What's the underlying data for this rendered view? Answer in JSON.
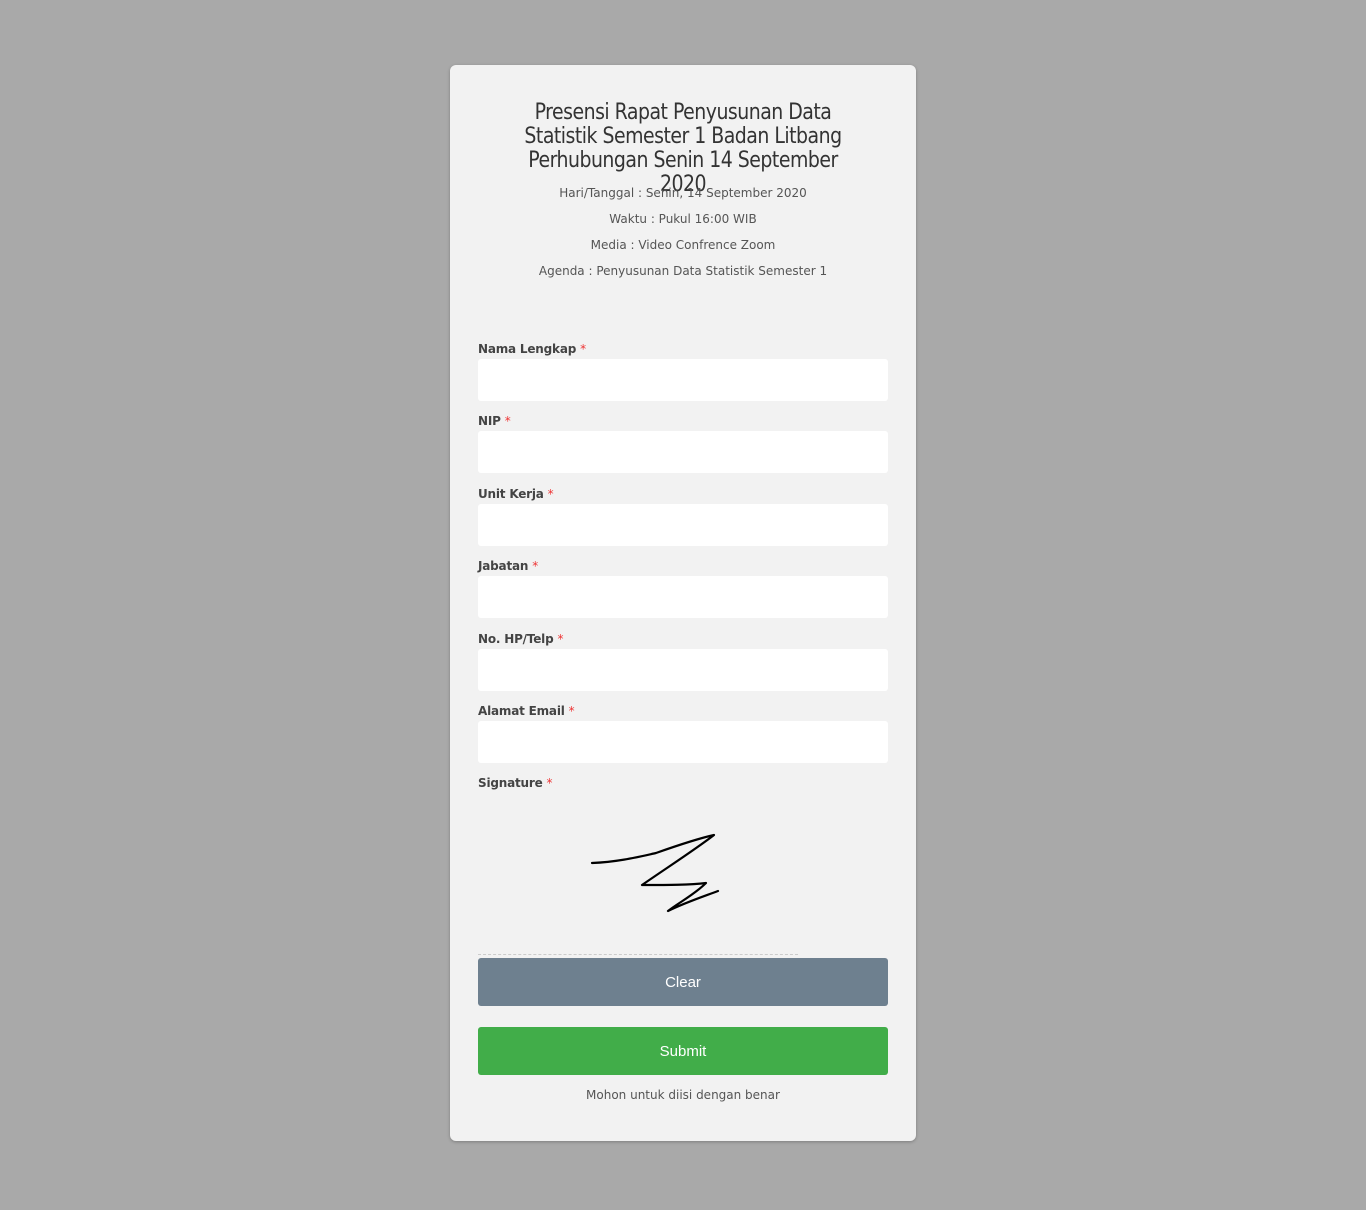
{
  "form": {
    "title": "Presensi Rapat Penyusunan Data Statistik Semester 1 Badan Litbang Perhubungan Senin 14 September 2020",
    "info": {
      "date": "Hari/Tanggal : Senin, 14 September 2020",
      "time": "Waktu : Pukul 16:00 WIB",
      "media": "Media : Video Confrence Zoom",
      "agenda": "Agenda : Penyusunan Data Statistik Semester 1"
    },
    "required_marker": "*",
    "fields": {
      "nama": {
        "label": "Nama Lengkap",
        "value": ""
      },
      "nip": {
        "label": "NIP",
        "value": ""
      },
      "unit": {
        "label": "Unit Kerja",
        "value": ""
      },
      "jabatan": {
        "label": "Jabatan",
        "value": ""
      },
      "phone": {
        "label": "No. HP/Telp",
        "value": ""
      },
      "email": {
        "label": "Alamat Email",
        "value": ""
      }
    },
    "signature": {
      "label": "Signature"
    },
    "clear_label": "Clear",
    "submit_label": "Submit",
    "footer_note": "Mohon untuk diisi dengan benar"
  },
  "colors": {
    "background": "#a9a9a9",
    "card": "#f2f2f2",
    "clear_button": "#6e808f",
    "submit_button": "#41ad49",
    "required": "#ee3333"
  }
}
